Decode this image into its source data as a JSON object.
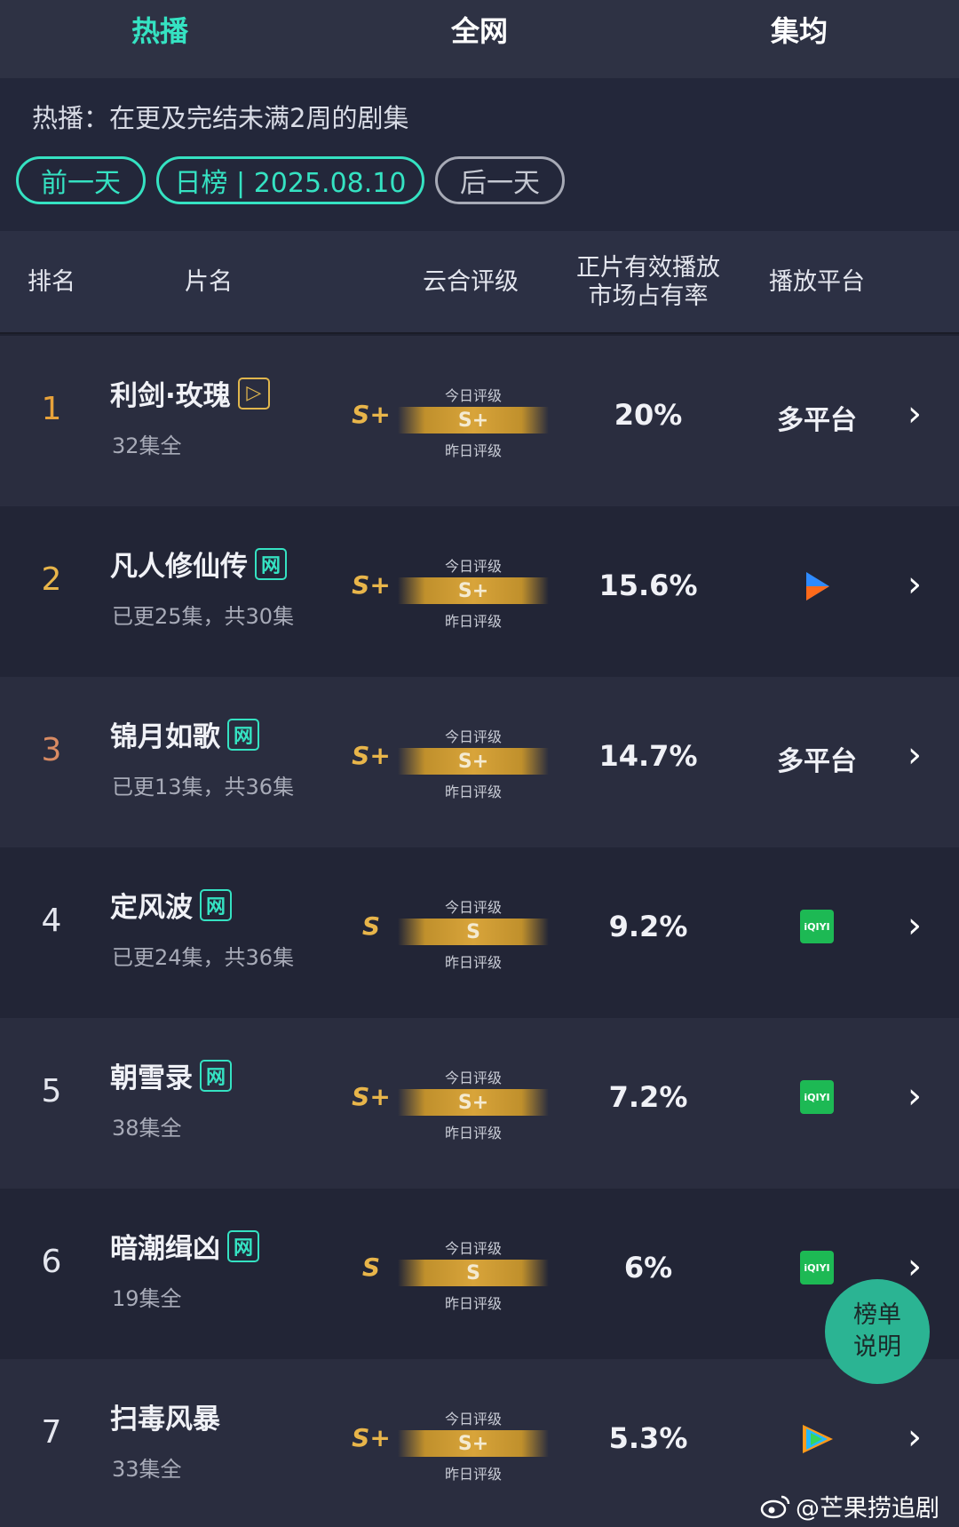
{
  "tabs": [
    "热播",
    "全网",
    "集均"
  ],
  "info": {
    "text": "热播：在更及完结未满2周的剧集",
    "prev_day": "前一天",
    "date_label": "日榜 | 2025.08.10",
    "next_day": "后一天"
  },
  "header": {
    "rank": "排名",
    "title": "片名",
    "rating": "云合评级",
    "share_l1": "正片有效播放",
    "share_l2": "市场占有率",
    "platform": "播放平台"
  },
  "grade_today": "今日评级",
  "grade_yesterday": "昨日评级",
  "rows": [
    {
      "rank": "1",
      "title": "利剑·玫瑰",
      "badge": "▷",
      "sub": "32集全",
      "grade": "S+",
      "bar": "S+",
      "share": "20%",
      "platform": "多平台",
      "platform_icon": ""
    },
    {
      "rank": "2",
      "title": "凡人修仙传",
      "badge": "网",
      "sub": "已更25集，共30集",
      "grade": "S+",
      "bar": "S+",
      "share": "15.6%",
      "platform": "",
      "platform_icon": "youku-icon"
    },
    {
      "rank": "3",
      "title": "锦月如歌",
      "badge": "网",
      "sub": "已更13集，共36集",
      "grade": "S+",
      "bar": "S+",
      "share": "14.7%",
      "platform": "多平台",
      "platform_icon": ""
    },
    {
      "rank": "4",
      "title": "定风波",
      "badge": "网",
      "sub": "已更24集，共36集",
      "grade": "S",
      "bar": "S",
      "share": "9.2%",
      "platform": "",
      "platform_icon": "iqiyi-icon"
    },
    {
      "rank": "5",
      "title": "朝雪录",
      "badge": "网",
      "sub": "38集全",
      "grade": "S+",
      "bar": "S+",
      "share": "7.2%",
      "platform": "",
      "platform_icon": "iqiyi-icon"
    },
    {
      "rank": "6",
      "title": "暗潮缉凶",
      "badge": "网",
      "sub": "19集全",
      "grade": "S",
      "bar": "S",
      "share": "6%",
      "platform": "",
      "platform_icon": "iqiyi-icon"
    },
    {
      "rank": "7",
      "title": "扫毒风暴",
      "badge": "",
      "sub": "33集全",
      "grade": "S+",
      "bar": "S+",
      "share": "5.3%",
      "platform": "",
      "platform_icon": "tencent-video-icon"
    }
  ],
  "iqiyi_text": "iQIYI",
  "fab": {
    "l1": "榜单",
    "l2": "说明"
  },
  "credit": "@芒果捞追剧",
  "colors": {
    "accent": "#35e2c2",
    "gold": "#e0b64d",
    "bg": "#1f2232"
  }
}
